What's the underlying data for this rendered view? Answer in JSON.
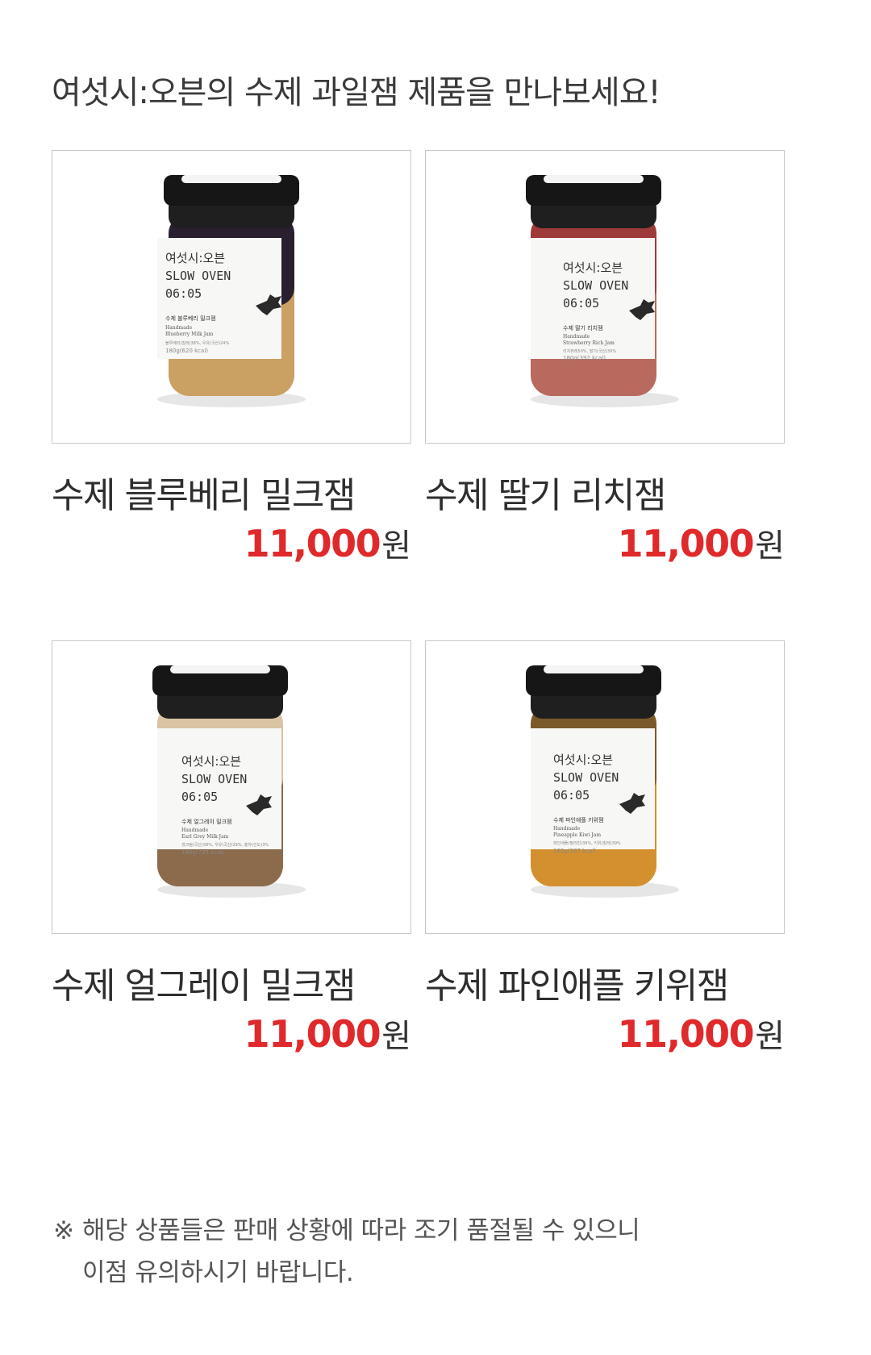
{
  "headline": "여섯시:오븐의 수제 과일잼 제품을 만나보세요!",
  "products": [
    {
      "name": "수제 블루베리 밀크잼",
      "price": "11,000",
      "currency": "원",
      "label": {
        "brand_kr": "여섯시:오븐",
        "brand_en": "SLOW OVEN",
        "time": "06:05",
        "product_kr": "수제 블루베리 밀크잼",
        "handmade": "Handmade",
        "product_en": "Blueberry Milk Jam",
        "ingredients": "블루베리(칠레)38%, 우유(국산)24%",
        "weight": "180g(620 kcal)"
      },
      "colors": {
        "top": "#2a1f2e",
        "bottom": "#caa063"
      }
    },
    {
      "name": "수제 딸기 리치잼",
      "price": "11,000",
      "currency": "원",
      "label": {
        "brand_kr": "여섯시:오븐",
        "brand_en": "SLOW OVEN",
        "time": "06:05",
        "product_kr": "수제 딸기 리치잼",
        "handmade": "Handmade",
        "product_en": "Strawberry Rich Jam",
        "ingredients": "리치퓨레50%, 딸기(국산)30%",
        "weight": "180g(392 kcal)"
      },
      "colors": {
        "top": "#9e3a3a",
        "bottom": "#b86a5e"
      }
    },
    {
      "name": "수제 얼그레이 밀크잼",
      "price": "11,000",
      "currency": "원",
      "label": {
        "brand_kr": "여섯시:오븐",
        "brand_en": "SLOW OVEN",
        "time": "06:05",
        "product_kr": "수제 얼그레이 밀크잼",
        "handmade": "Handmade",
        "product_en": "Earl Grey Milk Jam",
        "ingredients": "생크림(국산)38%, 우유(국산)29%, 홍차(인도)3%",
        "weight": "180g(725 kcal)"
      },
      "colors": {
        "top": "#d8c4a3",
        "bottom": "#8c6a4c"
      }
    },
    {
      "name": "수제 파인애플 키위잼",
      "price": "11,000",
      "currency": "원",
      "label": {
        "brand_kr": "여섯시:오븐",
        "brand_en": "SLOW OVEN",
        "time": "06:05",
        "product_kr": "수제 파인애플 키위잼",
        "handmade": "Handmade",
        "product_en": "Pineapple Kiwi Jam",
        "ingredients": "파인애플(필리핀)39%, 키위(칠레)39%",
        "weight": "180g(387 kcal)"
      },
      "colors": {
        "top": "#7a5a2a",
        "bottom": "#d4902e"
      }
    }
  ],
  "notice": {
    "mark": "※",
    "line1": "해당 상품들은 판매 상황에 따라 조기 품절될 수 있으니",
    "line2": "이점 유의하시기 바랍니다."
  }
}
